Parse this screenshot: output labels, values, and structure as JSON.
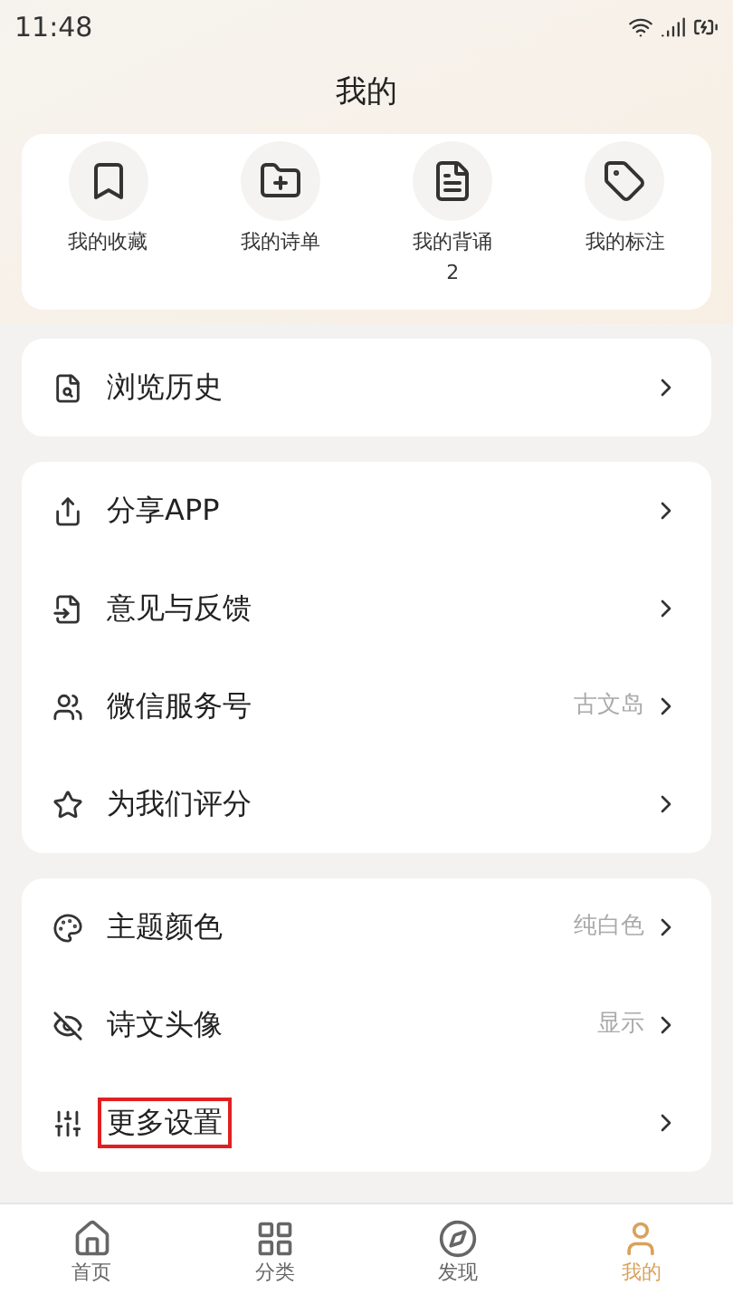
{
  "status_bar": {
    "time": "11:48"
  },
  "title": "我的",
  "shortcuts": [
    {
      "label": "我的收藏",
      "kind": "bookmark"
    },
    {
      "label": "我的诗单",
      "kind": "folder"
    },
    {
      "label": "我的背诵",
      "kind": "note",
      "count": "2"
    },
    {
      "label": "我的标注",
      "kind": "tag"
    }
  ],
  "groups": [
    [
      {
        "label": "浏览历史",
        "kind": "history",
        "highlighted": false
      }
    ],
    [
      {
        "label": "分享APP",
        "kind": "share",
        "highlighted": false
      },
      {
        "label": "意见与反馈",
        "kind": "feedback",
        "highlighted": false
      },
      {
        "label": "微信服务号",
        "kind": "wechat",
        "value": "古文岛",
        "highlighted": false
      },
      {
        "label": "为我们评分",
        "kind": "star",
        "highlighted": false
      }
    ],
    [
      {
        "label": "主题颜色",
        "kind": "theme",
        "value": "纯白色",
        "highlighted": false
      },
      {
        "label": "诗文头像",
        "kind": "eye",
        "value": "显示",
        "highlighted": false
      },
      {
        "label": "更多设置",
        "kind": "sliders",
        "highlighted": true
      }
    ]
  ],
  "tabs": [
    {
      "label": "首页",
      "kind": "home",
      "selected": false
    },
    {
      "label": "分类",
      "kind": "grid",
      "selected": false
    },
    {
      "label": "发现",
      "kind": "compass",
      "selected": false
    },
    {
      "label": "我的",
      "kind": "user",
      "selected": true
    }
  ]
}
